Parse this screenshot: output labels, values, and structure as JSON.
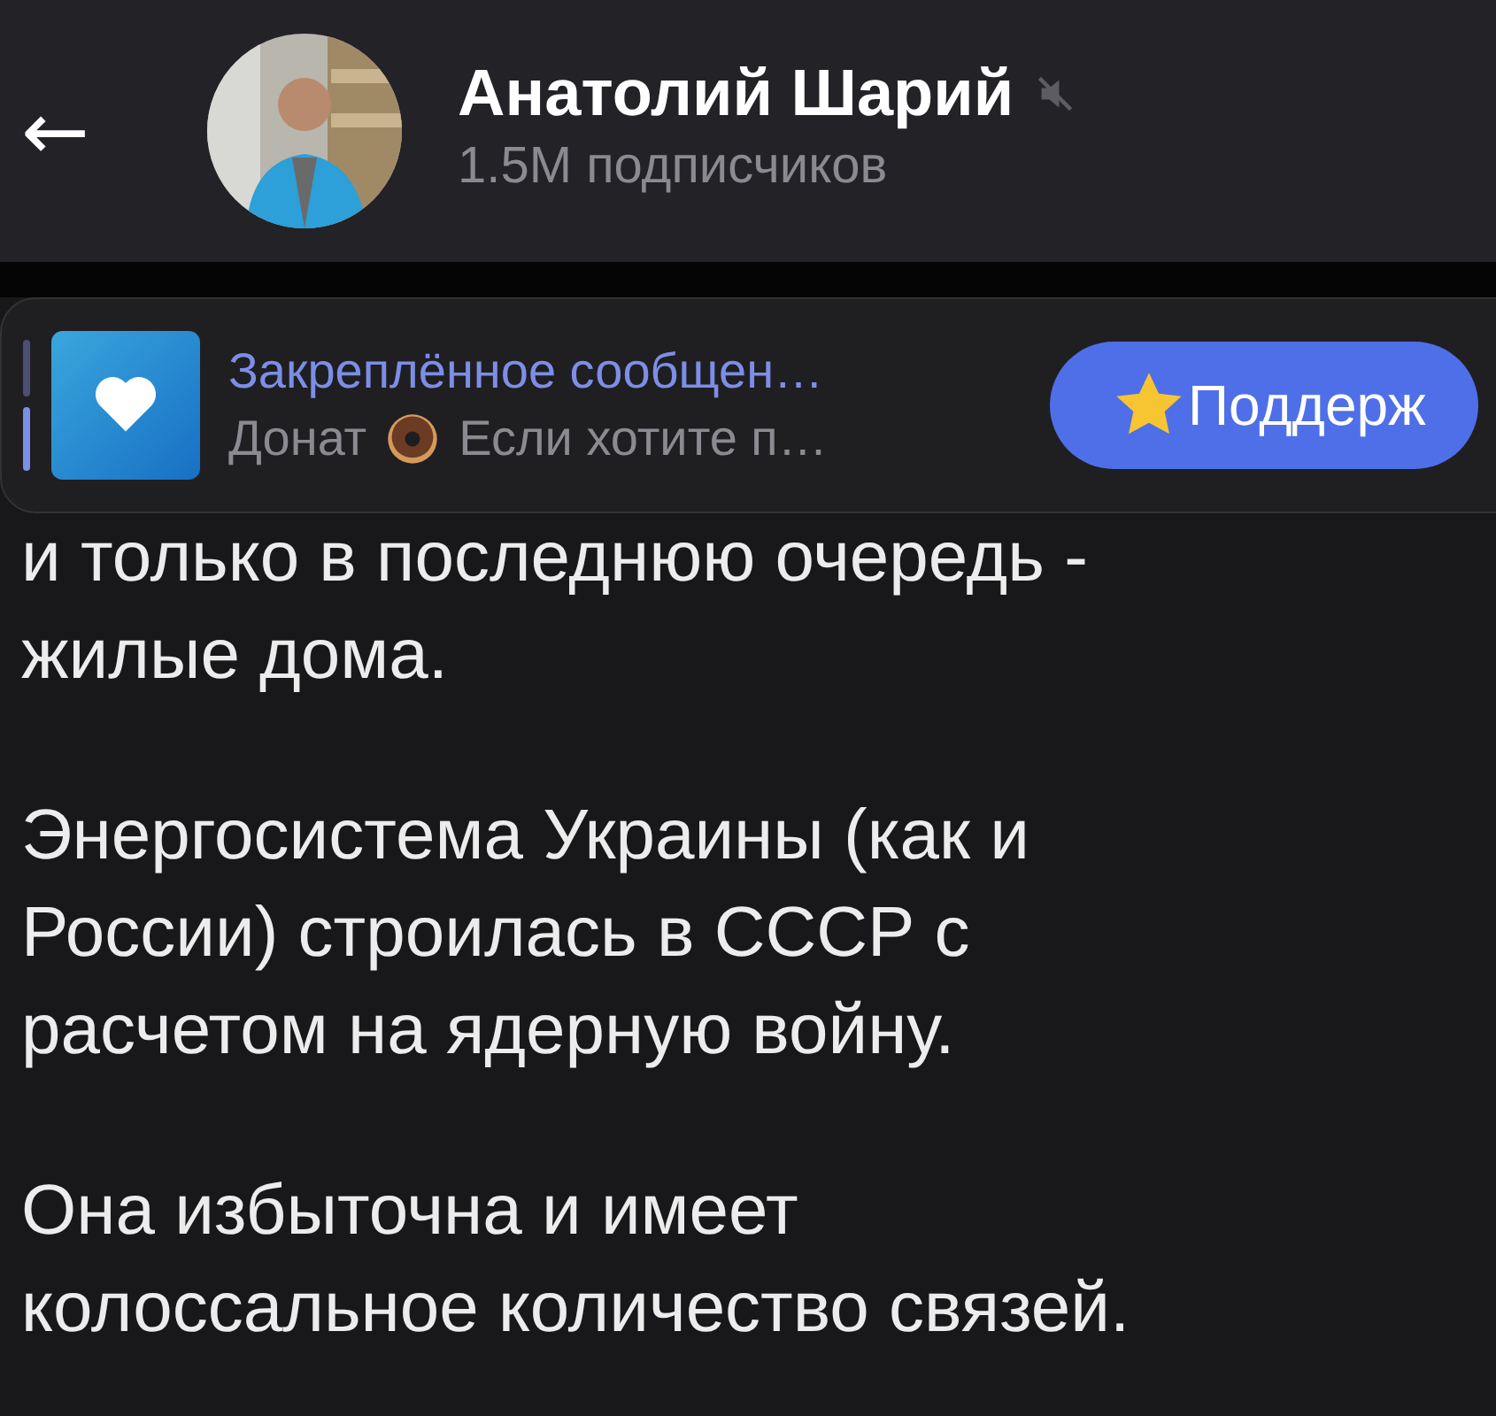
{
  "header": {
    "back_label": "←",
    "title": "Анатолий Шарий",
    "muted": true,
    "subtitle": "1.5M подписчиков"
  },
  "pinned": {
    "title": "Закреплённое сообщен…",
    "preview_lead": "Донат",
    "preview_text": "Если хотите п…",
    "button": "Поддерж"
  },
  "message": {
    "paragraphs": [
      [
        "и только в последнюю очередь -",
        "жилые дома."
      ],
      [
        "Энергосистема Украины (как и",
        "России) строилась в СССР с",
        "расчетом на ядерную войну."
      ],
      [
        "Она избыточна и имеет",
        "колоссальное количество связей."
      ]
    ]
  }
}
